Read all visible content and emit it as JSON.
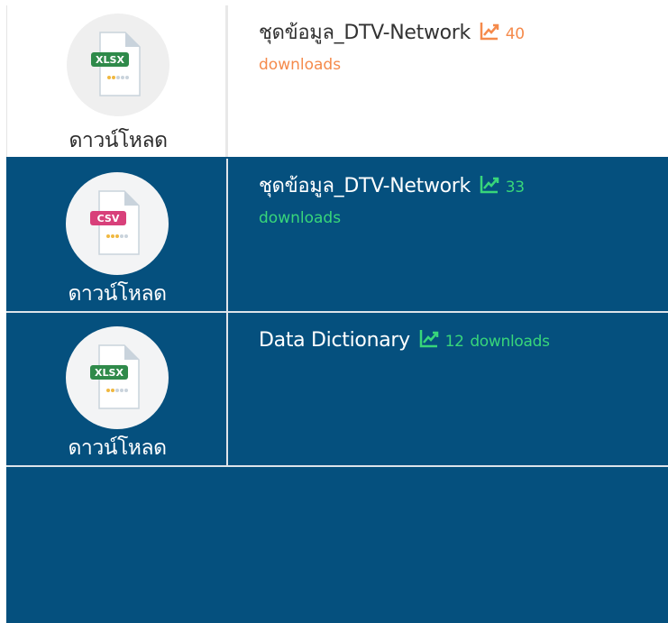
{
  "resources": [
    {
      "title": "ชุดข้อมูล_DTV-Network",
      "downloads_value": "40",
      "downloads_word": "downloads",
      "format": "XLSX",
      "download_label": "ดาวน์โหลด"
    },
    {
      "title": "ชุดข้อมูล_DTV-Network",
      "downloads_value": "33",
      "downloads_word": "downloads",
      "format": "CSV",
      "download_label": "ดาวน์โหลด"
    },
    {
      "title": "Data Dictionary",
      "downloads_value": "12",
      "downloads_word": "downloads",
      "format": "XLSX",
      "download_label": "ดาวน์โหลด"
    }
  ],
  "icons": {
    "trend": "trend-up-icon",
    "file": "file-icon"
  },
  "colors": {
    "panel": "#05507e",
    "xlsx_badge": "#2f8a4a",
    "csv_badge": "#d8407a",
    "count_orange": "#f58a4b",
    "count_green": "#38d67a"
  }
}
